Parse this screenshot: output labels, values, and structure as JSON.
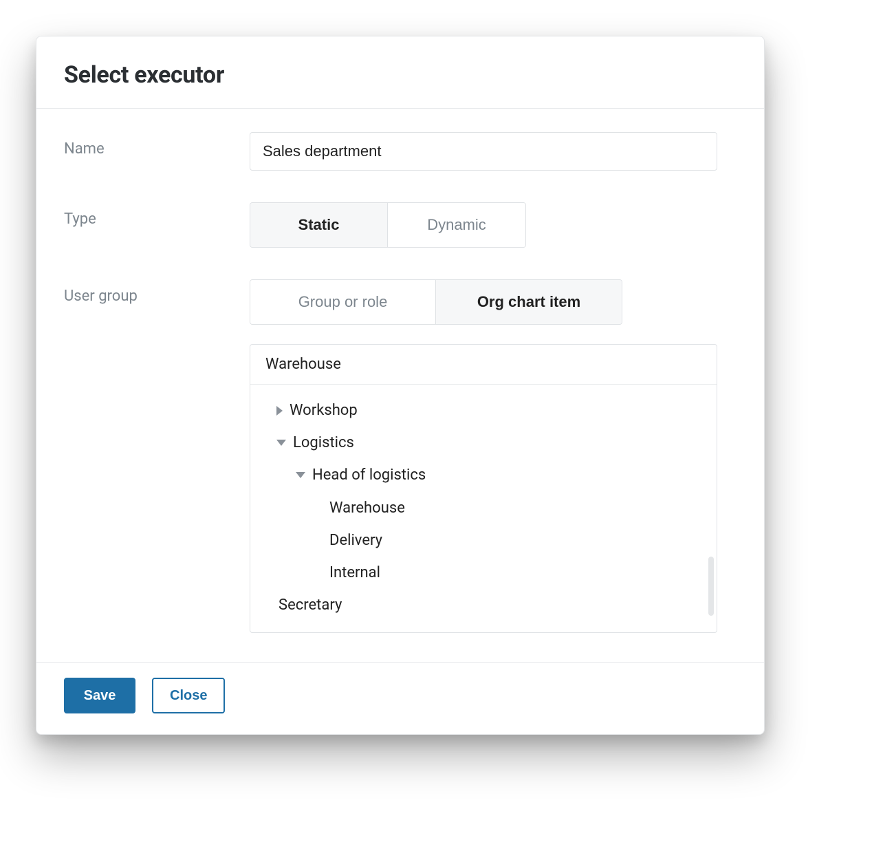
{
  "dialog": {
    "title": "Select executor",
    "fields": {
      "name_label": "Name",
      "name_value": "Sales department",
      "type_label": "Type",
      "type_options": {
        "static": "Static",
        "dynamic": "Dynamic"
      },
      "type_selected": "static",
      "usergroup_label": "User group",
      "usergroup_options": {
        "group_or_role": "Group or role",
        "org_chart_item": "Org chart item"
      },
      "usergroup_selected": "org_chart_item"
    },
    "tree": {
      "selected": "Warehouse",
      "nodes": [
        {
          "label": "Workshop",
          "level": 1,
          "expanded": false,
          "has_children": true
        },
        {
          "label": "Logistics",
          "level": 1,
          "expanded": true,
          "has_children": true
        },
        {
          "label": "Head of logistics",
          "level": 2,
          "expanded": true,
          "has_children": true
        },
        {
          "label": "Warehouse",
          "level": 3,
          "expanded": false,
          "has_children": false
        },
        {
          "label": "Delivery",
          "level": 3,
          "expanded": false,
          "has_children": false
        },
        {
          "label": "Internal",
          "level": 3,
          "expanded": false,
          "has_children": false
        },
        {
          "label": "Secretary",
          "level": 1,
          "expanded": false,
          "has_children": false
        }
      ]
    },
    "buttons": {
      "save": "Save",
      "close": "Close"
    }
  }
}
